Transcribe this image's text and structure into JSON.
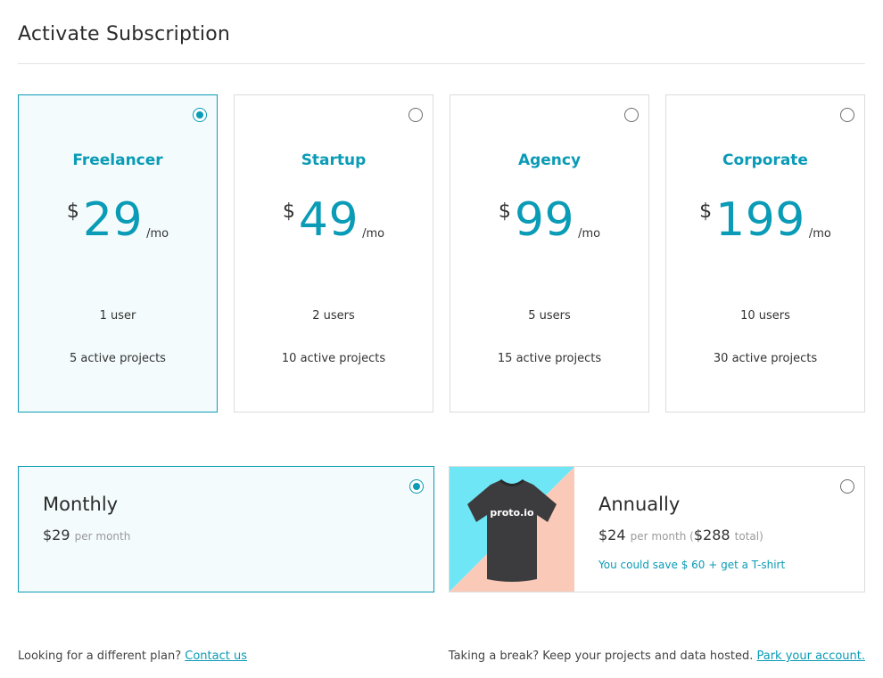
{
  "page": {
    "title": "Activate Subscription"
  },
  "plans": [
    {
      "name": "Freelancer",
      "currency": "$",
      "amount": "29",
      "period": "/mo",
      "users": "1 user",
      "projects": "5 active projects",
      "selected": true
    },
    {
      "name": "Startup",
      "currency": "$",
      "amount": "49",
      "period": "/mo",
      "users": "2 users",
      "projects": "10 active projects",
      "selected": false
    },
    {
      "name": "Agency",
      "currency": "$",
      "amount": "99",
      "period": "/mo",
      "users": "5 users",
      "projects": "15 active projects",
      "selected": false
    },
    {
      "name": "Corporate",
      "currency": "$",
      "amount": "199",
      "period": "/mo",
      "users": "10 users",
      "projects": "30 active projects",
      "selected": false
    }
  ],
  "billing": {
    "monthly": {
      "name": "Monthly",
      "price": "$29",
      "per": "per month",
      "selected": true
    },
    "annually": {
      "name": "Annually",
      "price": "$24",
      "per": "per month (",
      "total": "$288",
      "total_suffix": "total)",
      "save_note": "You could save $ 60 + get a T-shirt",
      "shirt_text": "proto.io",
      "selected": false
    }
  },
  "footer": {
    "left_text": "Looking for a different plan? ",
    "left_link": "Contact us",
    "right_text": "Taking a break? Keep your projects and data hosted. ",
    "right_link": "Park your account."
  },
  "colors": {
    "accent": "#0a9bb6",
    "selected_bg": "#f3fbfc",
    "shirt_bg_cyan": "#6fe6f5",
    "shirt_bg_peach": "#fbc9b8",
    "shirt": "#3c3c3e"
  }
}
